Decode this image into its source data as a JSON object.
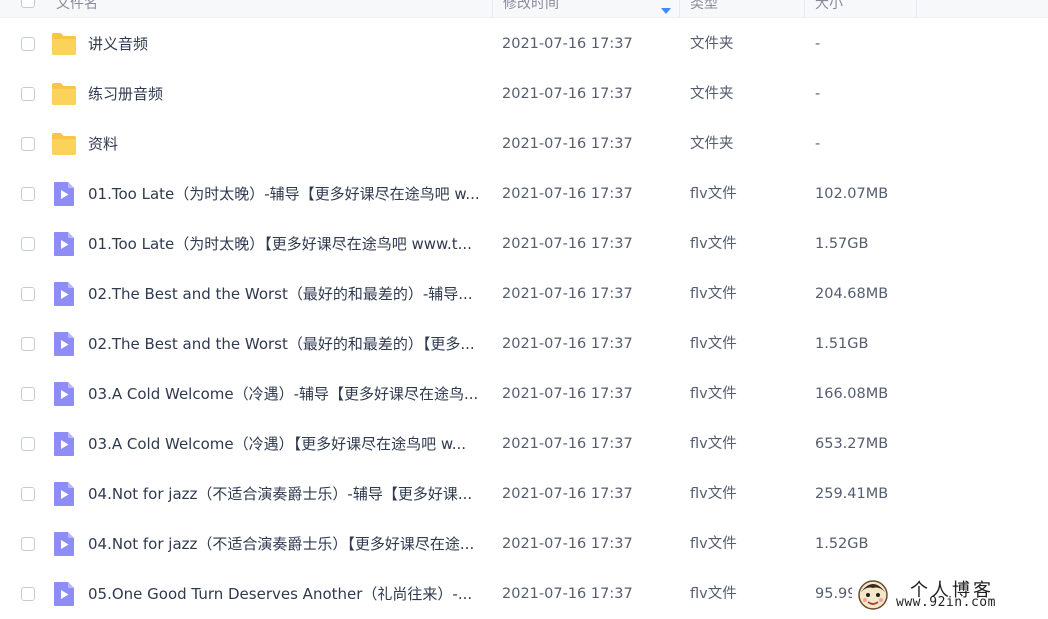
{
  "header": {
    "name": "文件名",
    "mtime": "修改时间",
    "type": "类型",
    "size": "大小"
  },
  "colors": {
    "folder": "#f7c644",
    "video": "#8e8cf5",
    "text": "#2f3a4f",
    "secondary_text": "#555d6e",
    "sort_arrow": "#3d8bff"
  },
  "rows": [
    {
      "icon": "folder-icon",
      "name": "讲义音频",
      "mtime": "2021-07-16 17:37",
      "type": "文件夹",
      "size": "-"
    },
    {
      "icon": "folder-icon",
      "name": "练习册音频",
      "mtime": "2021-07-16 17:37",
      "type": "文件夹",
      "size": "-"
    },
    {
      "icon": "folder-icon",
      "name": "资料",
      "mtime": "2021-07-16 17:37",
      "type": "文件夹",
      "size": "-"
    },
    {
      "icon": "video-file-icon",
      "name": "01.Too Late（为时太晚）-辅导【更多好课尽在途鸟吧 w...",
      "mtime": "2021-07-16 17:37",
      "type": "flv文件",
      "size": "102.07MB"
    },
    {
      "icon": "video-file-icon",
      "name": "01.Too Late（为时太晚）【更多好课尽在途鸟吧 www.t...",
      "mtime": "2021-07-16 17:37",
      "type": "flv文件",
      "size": "1.57GB"
    },
    {
      "icon": "video-file-icon",
      "name": "02.The Best and the Worst（最好的和最差的）-辅导...",
      "mtime": "2021-07-16 17:37",
      "type": "flv文件",
      "size": "204.68MB"
    },
    {
      "icon": "video-file-icon",
      "name": "02.The Best and the Worst（最好的和最差的）【更多...",
      "mtime": "2021-07-16 17:37",
      "type": "flv文件",
      "size": "1.51GB"
    },
    {
      "icon": "video-file-icon",
      "name": "03.A Cold Welcome（冷遇）-辅导【更多好课尽在途鸟...",
      "mtime": "2021-07-16 17:37",
      "type": "flv文件",
      "size": "166.08MB"
    },
    {
      "icon": "video-file-icon",
      "name": "03.A Cold Welcome（冷遇）【更多好课尽在途鸟吧 w...",
      "mtime": "2021-07-16 17:37",
      "type": "flv文件",
      "size": "653.27MB"
    },
    {
      "icon": "video-file-icon",
      "name": "04.Not for jazz（不适合演奏爵士乐）-辅导【更多好课...",
      "mtime": "2021-07-16 17:37",
      "type": "flv文件",
      "size": "259.41MB"
    },
    {
      "icon": "video-file-icon",
      "name": "04.Not for jazz（不适合演奏爵士乐）【更多好课尽在途...",
      "mtime": "2021-07-16 17:37",
      "type": "flv文件",
      "size": "1.52GB"
    },
    {
      "icon": "video-file-icon",
      "name": "05.One Good Turn Deserves Another（礼尚往来）-...",
      "mtime": "2021-07-16 17:37",
      "type": "flv文件",
      "size": "95.99"
    }
  ],
  "watermark": {
    "title": "个人博客",
    "url": "www.92in.com"
  }
}
